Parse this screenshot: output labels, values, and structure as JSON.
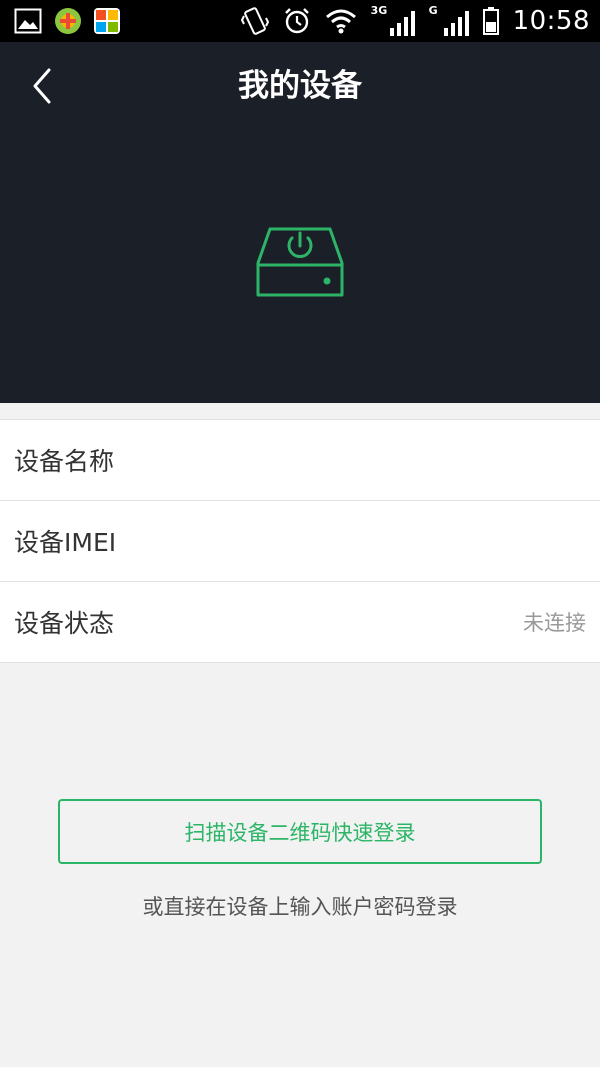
{
  "status_bar": {
    "time": "10:58",
    "network_3g": "3G",
    "network_g": "G",
    "icons": [
      "gallery-icon",
      "app-icon-game",
      "app-icon-tiles",
      "vibrate-icon",
      "alarm-icon",
      "wifi-icon",
      "signal-3g-icon",
      "signal-g-icon",
      "battery-icon"
    ]
  },
  "header": {
    "title": "我的设备"
  },
  "device": {
    "icon": "device-power-icon",
    "accent_color": "#2db567"
  },
  "list": {
    "rows": [
      {
        "label": "设备名称",
        "value": ""
      },
      {
        "label": "设备IMEI",
        "value": ""
      },
      {
        "label": "设备状态",
        "value": "未连接"
      }
    ]
  },
  "actions": {
    "scan_button": "扫描设备二维码快速登录",
    "alt_login": "或直接在设备上输入账户密码登录"
  },
  "colors": {
    "header_bg": "#1b1f28",
    "page_bg": "#f2f2f2",
    "accent": "#2db567"
  }
}
